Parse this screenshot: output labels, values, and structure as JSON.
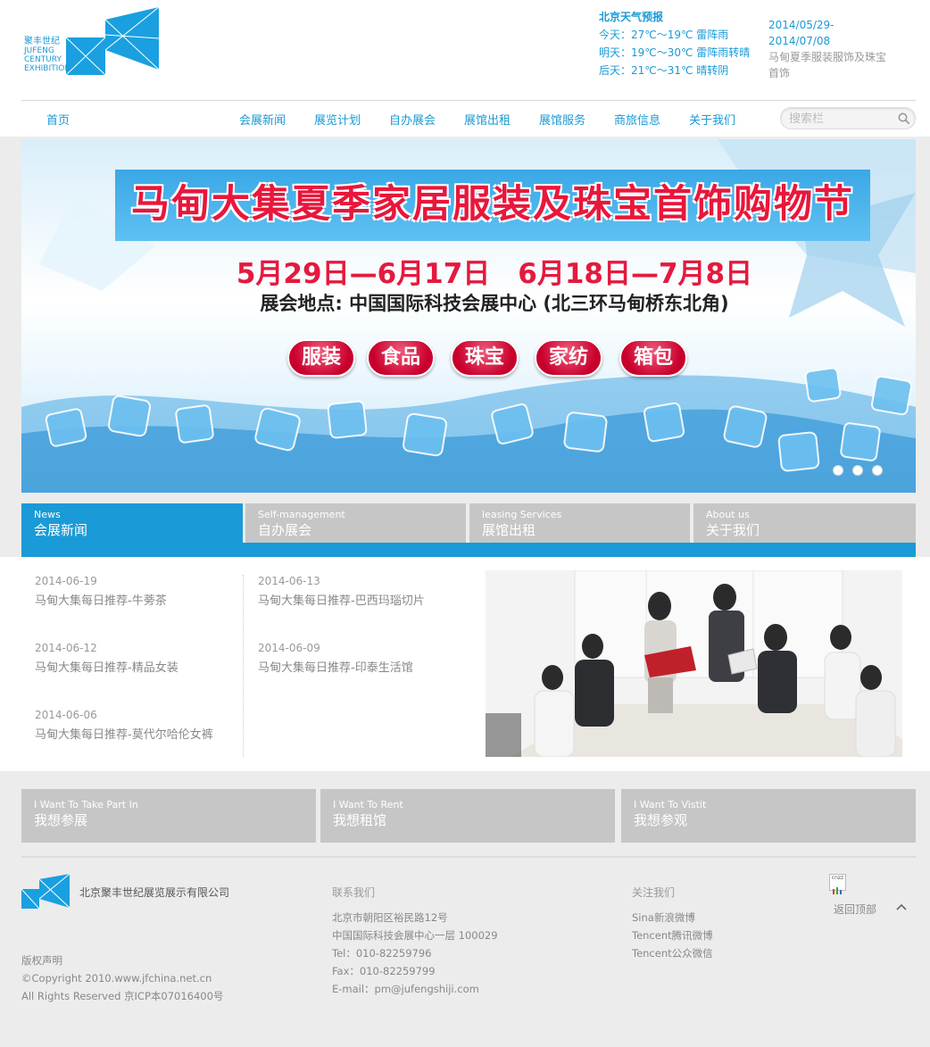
{
  "header": {
    "logo": {
      "cn": "聚丰世纪",
      "en_lines": [
        "JUFENG",
        "CENTURY",
        "EXHIBITION"
      ]
    },
    "weather": {
      "title": "北京天气预报",
      "lines": [
        "今天：27℃～19℃ 雷阵雨",
        "明天：19℃～30℃ 雷阵雨转晴",
        "后天：21℃～31℃ 晴转阴"
      ]
    },
    "exhibition": {
      "dates": "2014/05/29-2014/07/08",
      "title": "马甸夏季服装服饰及珠宝首饰"
    }
  },
  "nav": {
    "home": "首页",
    "items": [
      "会展新闻",
      "展览计划",
      "自办展会",
      "展馆出租",
      "展馆服务",
      "商旅信息",
      "关于我们"
    ],
    "search_placeholder": "搜索栏"
  },
  "banner": {
    "title": "马甸大集夏季家居服装及珠宝首饰购物节",
    "dates": "5月29日—6月17日　6月18日—7月8日",
    "venue": "展会地点: 中国国际科技会展中心 (北三环马甸桥东北角)",
    "categories": [
      "服装",
      "食品",
      "珠宝",
      "家纺",
      "箱包"
    ],
    "slide_count": 3
  },
  "tabs": [
    {
      "en": "News",
      "zh": "会展新闻",
      "active": true
    },
    {
      "en": "Self-management",
      "zh": "自办展会",
      "active": false
    },
    {
      "en": "leasing Services",
      "zh": "展馆出租",
      "active": false
    },
    {
      "en": "About us",
      "zh": "关于我们",
      "active": false
    }
  ],
  "news": [
    {
      "date": "2014-06-19",
      "title": "马甸大集每日推荐-牛蒡茶"
    },
    {
      "date": "2014-06-13",
      "title": "马甸大集每日推荐-巴西玛瑙切片"
    },
    {
      "date": "2014-06-12",
      "title": "马甸大集每日推荐-精品女装"
    },
    {
      "date": "2014-06-09",
      "title": "马甸大集每日推荐-印泰生活馆"
    },
    {
      "date": "2014-06-06",
      "title": "马甸大集每日推荐-莫代尔哈伦女裤"
    }
  ],
  "cta": [
    {
      "en": "I Want To Take Part In",
      "zh": "我想参展"
    },
    {
      "en": "I Want To Rent",
      "zh": "我想租馆"
    },
    {
      "en": "I Want To Vistit",
      "zh": "我想参观"
    }
  ],
  "footer": {
    "company": "北京聚丰世纪展览展示有限公司",
    "copyright": [
      "版权声明",
      "©Copyright 2010.www.jfchina.net.cn",
      "All Rights Reserved 京ICP本07016400号"
    ],
    "contact": {
      "title": "联系我们",
      "lines": [
        "北京市朝阳区裕民路12号",
        "中国国际科技会展中心一层 100029",
        "Tel：010-82259796",
        "Fax：010-82259799",
        "E-mail：pm@jufengshiji.com"
      ]
    },
    "follow": {
      "title": "关注我们",
      "lines": [
        "Sina新浪微博",
        "Tencent腾讯微博",
        "Tencent公众微信"
      ]
    },
    "stat_badge": "cnzz",
    "back_to_top": "返回顶部"
  },
  "colors": {
    "accent": "#1a9ad6",
    "tab_inactive": "#c6c6c6",
    "band": "#ececec",
    "banner_red": "#e5193e"
  }
}
